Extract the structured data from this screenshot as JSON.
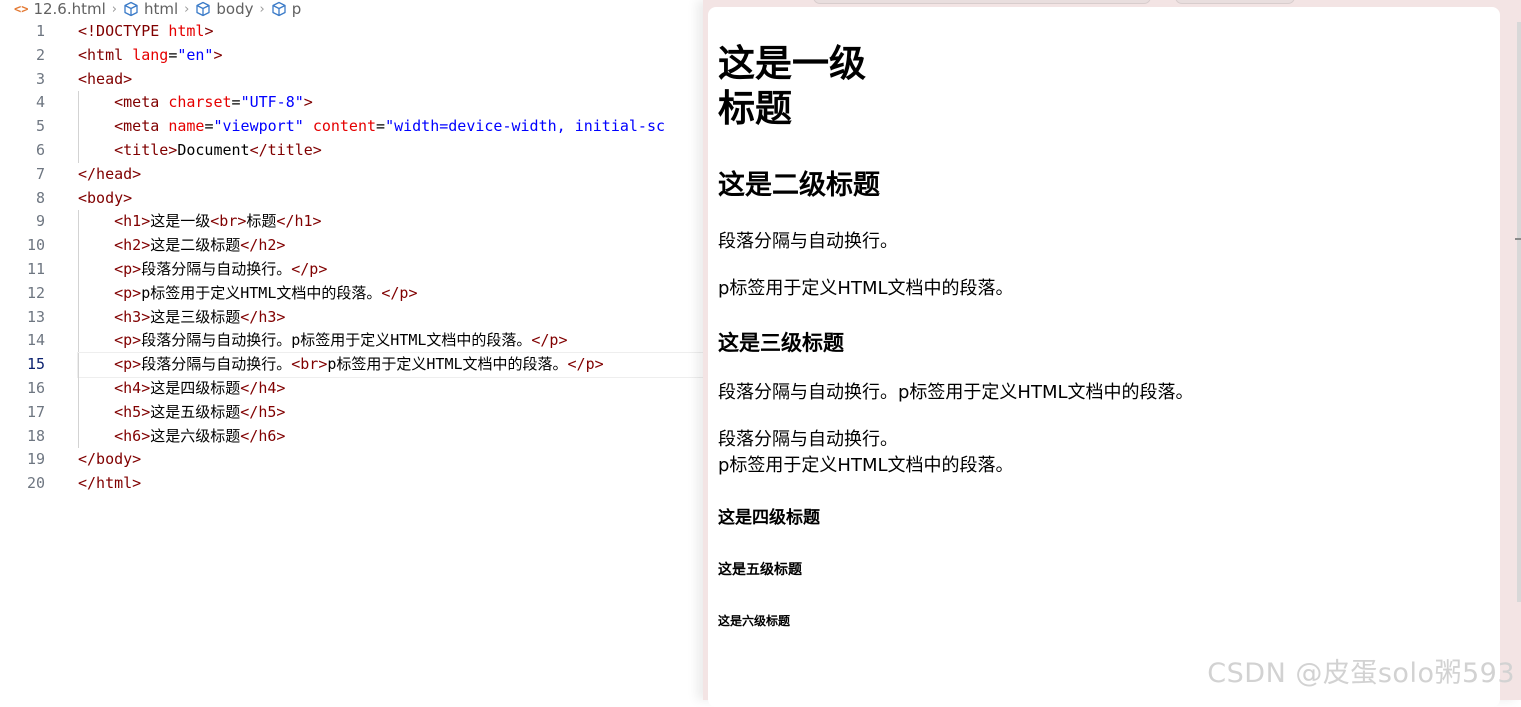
{
  "breadcrumb": {
    "file": "12.6.html",
    "items": [
      "html",
      "body",
      "p"
    ]
  },
  "code_lines": [
    {
      "num": "1",
      "indent": "",
      "parts": [
        [
          "t",
          "<!DOCTYPE "
        ],
        [
          "a",
          "html"
        ],
        [
          "t",
          ">"
        ]
      ]
    },
    {
      "num": "2",
      "indent": "",
      "parts": [
        [
          "t",
          "<html "
        ],
        [
          "a",
          "lang"
        ],
        [
          "x",
          "="
        ],
        [
          "v",
          "\"en\""
        ],
        [
          "t",
          ">"
        ]
      ]
    },
    {
      "num": "3",
      "indent": "",
      "parts": [
        [
          "t",
          "<head>"
        ]
      ]
    },
    {
      "num": "4",
      "indent": "    ",
      "parts": [
        [
          "t",
          "<meta "
        ],
        [
          "a",
          "charset"
        ],
        [
          "x",
          "="
        ],
        [
          "v",
          "\"UTF-8\""
        ],
        [
          "t",
          ">"
        ]
      ]
    },
    {
      "num": "5",
      "indent": "    ",
      "parts": [
        [
          "t",
          "<meta "
        ],
        [
          "a",
          "name"
        ],
        [
          "x",
          "="
        ],
        [
          "v",
          "\"viewport\" "
        ],
        [
          "a",
          "content"
        ],
        [
          "x",
          "="
        ],
        [
          "v",
          "\"width=device-width, initial-sc"
        ]
      ]
    },
    {
      "num": "6",
      "indent": "    ",
      "parts": [
        [
          "t",
          "<title>"
        ],
        [
          "x",
          "Document"
        ],
        [
          "t",
          "</title>"
        ]
      ]
    },
    {
      "num": "7",
      "indent": "",
      "parts": [
        [
          "t",
          "</head>"
        ]
      ]
    },
    {
      "num": "8",
      "indent": "",
      "parts": [
        [
          "t",
          "<body>"
        ]
      ]
    },
    {
      "num": "9",
      "indent": "    ",
      "parts": [
        [
          "t",
          "<h1>"
        ],
        [
          "x",
          "这是一级"
        ],
        [
          "t",
          "<br>"
        ],
        [
          "x",
          "标题"
        ],
        [
          "t",
          "</h1>"
        ]
      ]
    },
    {
      "num": "10",
      "indent": "    ",
      "parts": [
        [
          "t",
          "<h2>"
        ],
        [
          "x",
          "这是二级标题"
        ],
        [
          "t",
          "</h2>"
        ]
      ]
    },
    {
      "num": "11",
      "indent": "    ",
      "parts": [
        [
          "t",
          "<p>"
        ],
        [
          "x",
          "段落分隔与自动换行。"
        ],
        [
          "t",
          "</p>"
        ]
      ]
    },
    {
      "num": "12",
      "indent": "    ",
      "parts": [
        [
          "t",
          "<p>"
        ],
        [
          "x",
          "p标签用于定义HTML文档中的段落。"
        ],
        [
          "t",
          "</p>"
        ]
      ]
    },
    {
      "num": "13",
      "indent": "    ",
      "parts": [
        [
          "t",
          "<h3>"
        ],
        [
          "x",
          "这是三级标题"
        ],
        [
          "t",
          "</h3>"
        ]
      ]
    },
    {
      "num": "14",
      "indent": "    ",
      "parts": [
        [
          "t",
          "<p>"
        ],
        [
          "x",
          "段落分隔与自动换行。p标签用于定义HTML文档中的段落。"
        ],
        [
          "t",
          "</p>"
        ]
      ]
    },
    {
      "num": "15",
      "indent": "    ",
      "parts": [
        [
          "t",
          "<p>"
        ],
        [
          "x",
          "段落分隔与自动换行。"
        ],
        [
          "t",
          "<br>"
        ],
        [
          "x",
          "p标签用于定义HTML文档中的段落。"
        ],
        [
          "t",
          "</p>"
        ]
      ],
      "active": true
    },
    {
      "num": "16",
      "indent": "    ",
      "parts": [
        [
          "t",
          "<h4>"
        ],
        [
          "x",
          "这是四级标题"
        ],
        [
          "t",
          "</h4>"
        ]
      ]
    },
    {
      "num": "17",
      "indent": "    ",
      "parts": [
        [
          "t",
          "<h5>"
        ],
        [
          "x",
          "这是五级标题"
        ],
        [
          "t",
          "</h5>"
        ]
      ]
    },
    {
      "num": "18",
      "indent": "    ",
      "parts": [
        [
          "t",
          "<h6>"
        ],
        [
          "x",
          "这是六级标题"
        ],
        [
          "t",
          "</h6>"
        ]
      ]
    },
    {
      "num": "19",
      "indent": "",
      "parts": [
        [
          "t",
          "</body>"
        ]
      ]
    },
    {
      "num": "20",
      "indent": "",
      "parts": [
        [
          "t",
          "</html>"
        ]
      ]
    }
  ],
  "preview": {
    "h1_line1": "这是一级",
    "h1_line2": "标题",
    "h2": "这是二级标题",
    "p1": "段落分隔与自动换行。",
    "p2": "p标签用于定义HTML文档中的段落。",
    "h3": "这是三级标题",
    "p3": "段落分隔与自动换行。p标签用于定义HTML文档中的段落。",
    "p4_line1": "段落分隔与自动换行。",
    "p4_line2": "p标签用于定义HTML文档中的段落。",
    "h4": "这是四级标题",
    "h5": "这是五级标题",
    "h6": "这是六级标题"
  },
  "watermark": "CSDN @皮蛋solo粥593",
  "colors": {
    "tag": "#800000",
    "attribute": "#e50000",
    "string": "#0000ff",
    "browser_frame": "#f3e4e4"
  }
}
